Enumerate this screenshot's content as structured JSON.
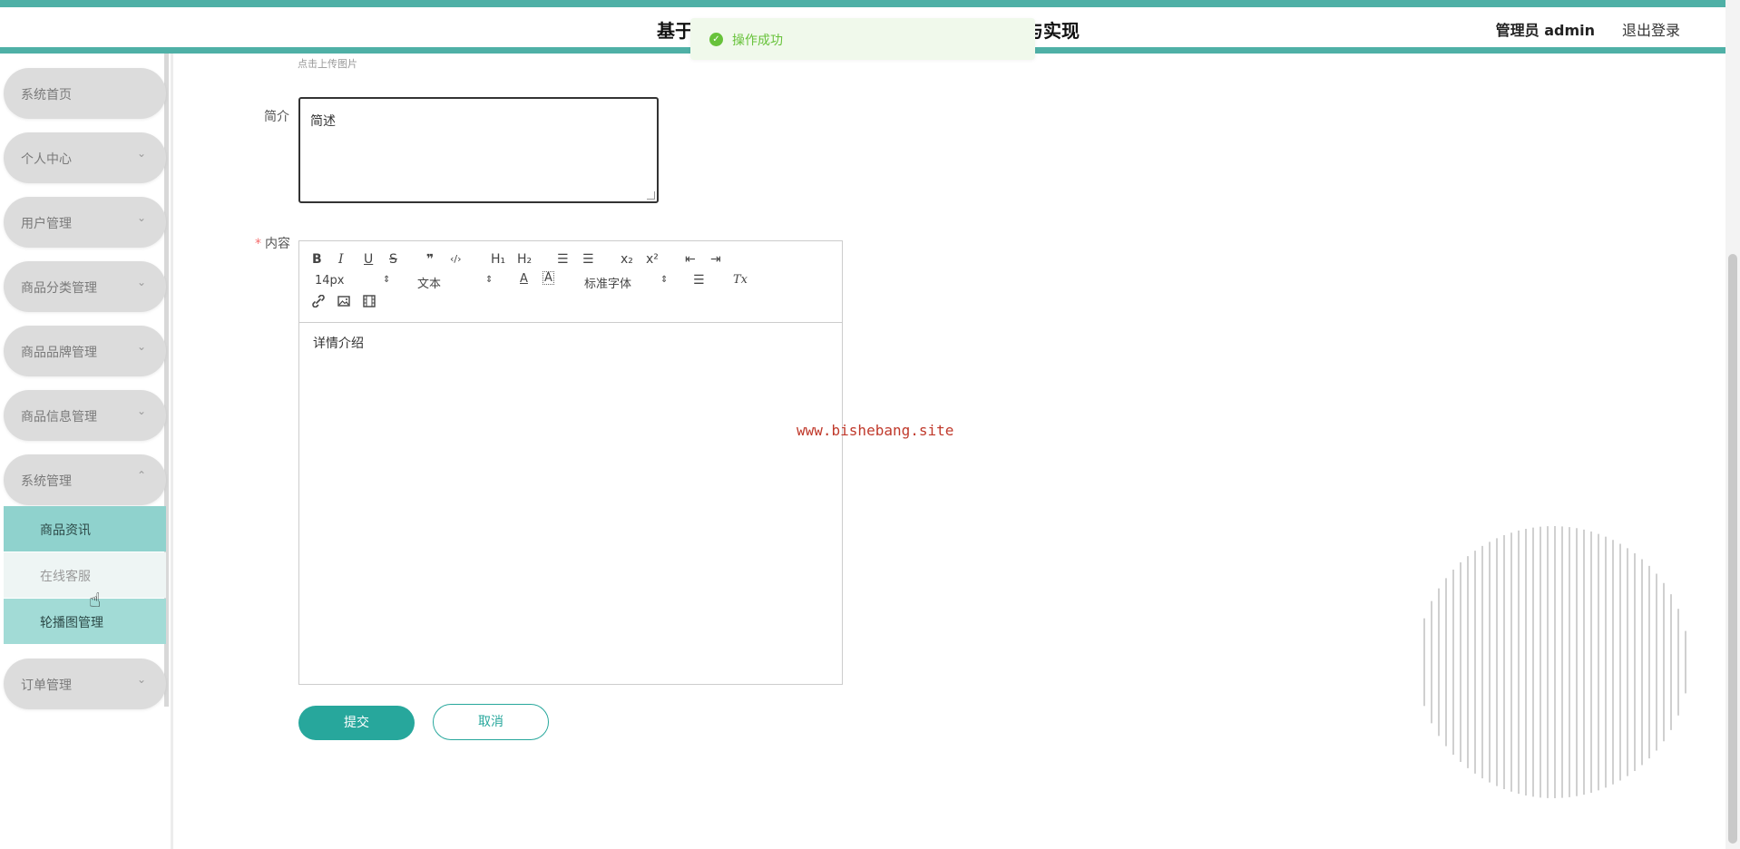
{
  "header": {
    "title_left": "基于",
    "title_right": "与实现",
    "user": "管理员 admin",
    "logout": "退出登录"
  },
  "toast": {
    "icon": "check-circle-icon",
    "message": "操作成功"
  },
  "sidebar": {
    "items": [
      {
        "label": "系统首页",
        "chevron": ""
      },
      {
        "label": "个人中心",
        "chevron": "⌄"
      },
      {
        "label": "用户管理",
        "chevron": "⌄"
      },
      {
        "label": "商品分类管理",
        "chevron": "⌄"
      },
      {
        "label": "商品品牌管理",
        "chevron": "⌄"
      },
      {
        "label": "商品信息管理",
        "chevron": "⌄"
      },
      {
        "label": "系统管理",
        "chevron": "⌃"
      },
      {
        "label": "订单管理",
        "chevron": "⌄"
      }
    ],
    "submenu": [
      {
        "label": "商品资讯"
      },
      {
        "label": "在线客服"
      },
      {
        "label": "轮播图管理"
      }
    ]
  },
  "form": {
    "upload_hint": "点击上传图片",
    "intro_label": "简介",
    "intro_value": "简述",
    "content_label": "内容",
    "required_mark": "*",
    "editor": {
      "toolbar": {
        "bold": "B",
        "italic": "I",
        "underline": "U",
        "strike": "S",
        "quote": "❞",
        "code": "‹/›",
        "h1": "H₁",
        "h2": "H₂",
        "ol": "☰",
        "ul": "☰",
        "sub": "x₂",
        "sup": "x²",
        "indent_out": "⇤",
        "indent_in": "⇥",
        "size": "14px",
        "header": "文本",
        "font": "标准字体",
        "color": "A",
        "background": "A",
        "align": "☰",
        "clean": "Tx"
      },
      "content": "详情介绍"
    },
    "submit": "提交",
    "cancel": "取消"
  },
  "watermark": "www.bishebang.site"
}
